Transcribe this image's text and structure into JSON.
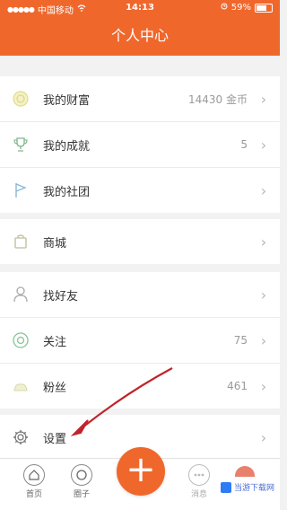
{
  "statusbar": {
    "carrier": "中国移动",
    "time": "14:13",
    "battery": "59%"
  },
  "header": {
    "title": "个人中心"
  },
  "groups": [
    {
      "rows": [
        {
          "label": "我的财富",
          "value": "14430 金币",
          "icon": "coin-icon"
        },
        {
          "label": "我的成就",
          "value": "5",
          "icon": "trophy-icon"
        },
        {
          "label": "我的社团",
          "value": "",
          "icon": "flag-icon"
        }
      ]
    },
    {
      "rows": [
        {
          "label": "商城",
          "value": "",
          "icon": "shopping-bag-icon"
        }
      ]
    },
    {
      "rows": [
        {
          "label": "找好友",
          "value": "",
          "icon": "person-icon"
        },
        {
          "label": "关注",
          "value": "75",
          "icon": "eye-icon"
        },
        {
          "label": "粉丝",
          "value": "461",
          "icon": "fans-icon"
        }
      ]
    },
    {
      "rows": [
        {
          "label": "设置",
          "value": "",
          "icon": "gear-icon"
        }
      ]
    }
  ],
  "tabbar": {
    "tabs": [
      {
        "label": "首页",
        "icon": "home-icon"
      },
      {
        "label": "圈子",
        "icon": "circle-icon"
      },
      {
        "label": "消息",
        "icon": "message-icon"
      }
    ],
    "fab_label": "+"
  },
  "watermark": {
    "text": "当游下载网"
  },
  "colors": {
    "accent": "#f0672c",
    "background": "#f2f2f2",
    "annotation_arrow": "#c0242b"
  }
}
